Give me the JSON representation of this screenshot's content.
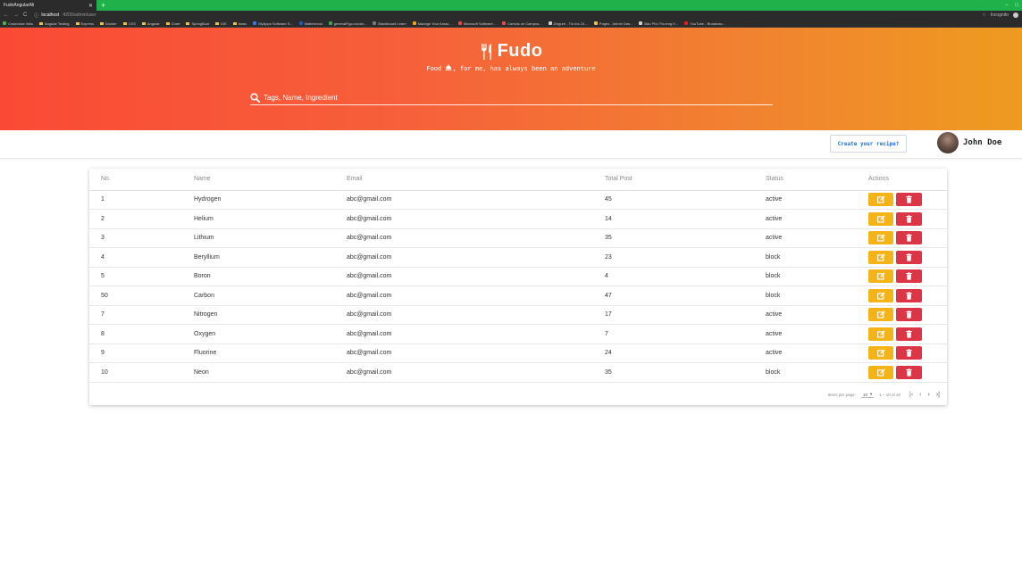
{
  "browser": {
    "tab_title": "FudoAngularAli",
    "url_host": "localhost",
    "url_path": ":4200/admin/user",
    "incognito_label": "Incognito",
    "bookmarks": [
      {
        "label": "Customize links",
        "kind": "fav",
        "color": "#4caf50"
      },
      {
        "label": "Angular Testing",
        "kind": "folder"
      },
      {
        "label": "Express",
        "kind": "folder"
      },
      {
        "label": "Docker",
        "kind": "folder"
      },
      {
        "label": "CSS",
        "kind": "folder"
      },
      {
        "label": "Angular",
        "kind": "folder"
      },
      {
        "label": "Chart",
        "kind": "folder"
      },
      {
        "label": "SpringBoot",
        "kind": "folder"
      },
      {
        "label": "IDE",
        "kind": "folder"
      },
      {
        "label": "basic",
        "kind": "folder"
      },
      {
        "label": "MyApps Software S...",
        "kind": "fav",
        "color": "#2a7de1"
      },
      {
        "label": "Mattermost",
        "kind": "fav",
        "color": "#1e5bb8"
      },
      {
        "label": "generalFigo-constr...",
        "kind": "fav",
        "color": "#3aa655"
      },
      {
        "label": "Blackboard Learn",
        "kind": "fav",
        "color": "#777777"
      },
      {
        "label": "Manage Your Amaz...",
        "kind": "fav",
        "color": "#f0a020"
      },
      {
        "label": "Microsoft Software...",
        "kind": "fav",
        "color": "#e04b4b"
      },
      {
        "label": "Canvas on Campus...",
        "kind": "fav",
        "color": "#e04b4b"
      },
      {
        "label": "Zingure - Tin tức 24...",
        "kind": "fav",
        "color": "#cccccc"
      },
      {
        "label": "Pages - Admin Das...",
        "kind": "fav",
        "color": "#f0c040"
      },
      {
        "label": "Bảo Phú Thương K...",
        "kind": "fav",
        "color": "#cccccc"
      },
      {
        "label": "YouTube - Broadcas...",
        "kind": "fav",
        "color": "#e02020"
      }
    ]
  },
  "header": {
    "brand": "Fudo",
    "tagline_before": "Food",
    "tagline_after": ", for me, has always been an adventure",
    "search_placeholder": "Tags, Name, Ingredient"
  },
  "toolbar": {
    "create_label": "Create your recipe?",
    "user_name": "John Doe"
  },
  "table": {
    "columns": [
      "No.",
      "Name",
      "Email",
      "Total Post",
      "Status",
      "Actions"
    ],
    "rows": [
      {
        "no": "1",
        "name": "Hydrogen",
        "email": "abc@gmail.com",
        "posts": "45",
        "status": "active"
      },
      {
        "no": "2",
        "name": "Helium",
        "email": "abc@gmail.com",
        "posts": "14",
        "status": "active"
      },
      {
        "no": "3",
        "name": "Lithium",
        "email": "abc@gmail.com",
        "posts": "35",
        "status": "active"
      },
      {
        "no": "4",
        "name": "Beryllium",
        "email": "abc@gmail.com",
        "posts": "23",
        "status": "block"
      },
      {
        "no": "5",
        "name": "Boron",
        "email": "abc@gmail.com",
        "posts": "4",
        "status": "block"
      },
      {
        "no": "50",
        "name": "Carbon",
        "email": "abc@gmail.com",
        "posts": "47",
        "status": "block"
      },
      {
        "no": "7",
        "name": "Nitrogen",
        "email": "abc@gmail.com",
        "posts": "17",
        "status": "active"
      },
      {
        "no": "8",
        "name": "Oxygen",
        "email": "abc@gmail.com",
        "posts": "7",
        "status": "active"
      },
      {
        "no": "9",
        "name": "Fluorine",
        "email": "abc@gmail.com",
        "posts": "24",
        "status": "active"
      },
      {
        "no": "10",
        "name": "Neon",
        "email": "abc@gmail.com",
        "posts": "35",
        "status": "block"
      }
    ]
  },
  "paginator": {
    "items_label": "Items per page:",
    "page_size": "10",
    "range": "1 – 10 of 20"
  },
  "colors": {
    "edit": "#f4b417",
    "delete": "#dc3646",
    "accent": "#1e6ee0"
  }
}
